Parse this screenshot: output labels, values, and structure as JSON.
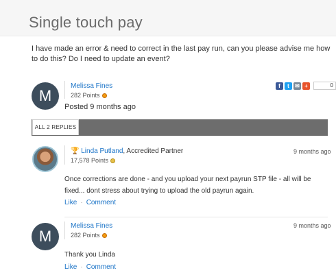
{
  "page": {
    "title": "Single touch pay"
  },
  "question": {
    "text": "I have made an error & need to correct in the last pay run, can you please advise me how to do this? Do I need to update an event?",
    "author": {
      "initial": "M",
      "name": "Melissa Fines",
      "points": "282 Points"
    },
    "posted": "Posted 9 months ago",
    "share": {
      "count": "0",
      "icons": [
        "facebook-icon",
        "twitter-icon",
        "email-icon",
        "plus-icon"
      ]
    }
  },
  "replies": {
    "tab_label": "ALL 2 REPLIES",
    "items": [
      {
        "name": "Linda Putland",
        "role": ", Accredited Partner",
        "points": "17,578 Points",
        "time": "9 months ago",
        "text": "Once corrections are done - and you upload your next payrun STP file - all will be fixed... dont stress about trying to upload the old payrun again.",
        "like": "Like",
        "comment": "Comment",
        "badge_icon": "trophy-icon"
      },
      {
        "initial": "M",
        "name": "Melissa Fines",
        "points": "282 Points",
        "time": "9 months ago",
        "text": "Thank you Linda",
        "like": "Like",
        "comment": "Comment"
      }
    ]
  },
  "colors": {
    "link": "#1a73c7",
    "avatar": "#3d4d5c",
    "bar": "#6d6d6d"
  }
}
